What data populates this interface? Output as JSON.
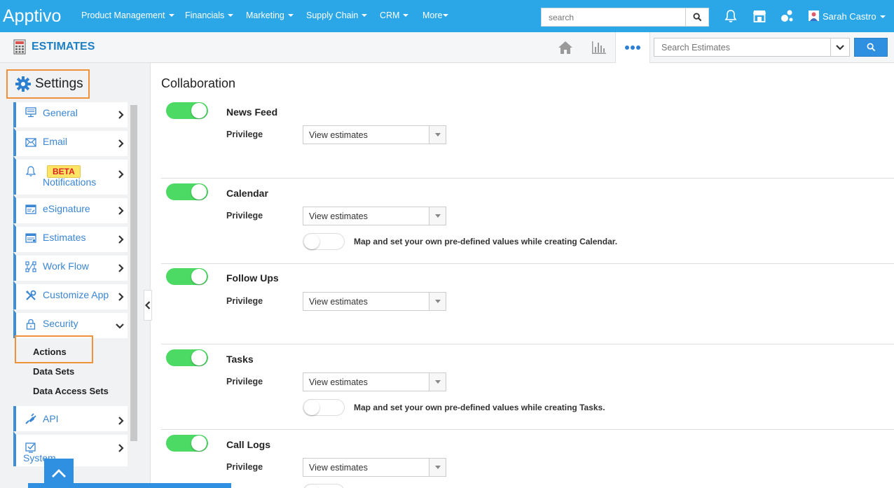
{
  "topnav": {
    "logo": "Apptivo",
    "items": [
      {
        "label": "Product Management"
      },
      {
        "label": "Financials"
      },
      {
        "label": "Marketing"
      },
      {
        "label": "Supply Chain"
      },
      {
        "label": "CRM"
      },
      {
        "label": "More"
      }
    ],
    "search_placeholder": "search",
    "user_name": "Sarah Castro"
  },
  "subheader": {
    "title": "ESTIMATES",
    "search_placeholder": "Search Estimates"
  },
  "sidebar": {
    "heading": "Settings",
    "items": [
      {
        "label": "General",
        "icon": "monitor-icon"
      },
      {
        "label": "Email",
        "icon": "envelope-icon"
      },
      {
        "label": "Notifications",
        "icon": "bell-icon",
        "badge": "BETA"
      },
      {
        "label": "eSignature",
        "icon": "signature-icon"
      },
      {
        "label": "Estimates",
        "icon": "document-icon"
      },
      {
        "label": "Work Flow",
        "icon": "workflow-icon"
      },
      {
        "label": "Customize App",
        "icon": "tools-icon"
      },
      {
        "label": "Security",
        "icon": "lock-icon",
        "expanded": true
      },
      {
        "label": "API",
        "icon": "plug-icon"
      },
      {
        "label": "System",
        "icon": "checkbox-icon"
      }
    ],
    "security_sub": [
      "Actions",
      "Data Sets",
      "Data Access Sets"
    ]
  },
  "main": {
    "title": "Collaboration",
    "privilege_label": "Privilege",
    "sections": [
      {
        "name": "News Feed",
        "enabled": true,
        "privilege": "View estimates"
      },
      {
        "name": "Calendar",
        "enabled": true,
        "privilege": "View estimates",
        "map_text": "Map and set your own pre-defined values while creating Calendar.",
        "map_enabled": false
      },
      {
        "name": "Follow Ups",
        "enabled": true,
        "privilege": "View estimates"
      },
      {
        "name": "Tasks",
        "enabled": true,
        "privilege": "View estimates",
        "map_text": "Map and set your own pre-defined values while creating Tasks.",
        "map_enabled": false
      },
      {
        "name": "Call Logs",
        "enabled": true,
        "privilege": "View estimates"
      }
    ]
  },
  "colors": {
    "topbar": "#2ba7e8",
    "accent": "#3a86d4",
    "toggle_on": "#4cd964",
    "highlight": "#f0923a"
  }
}
